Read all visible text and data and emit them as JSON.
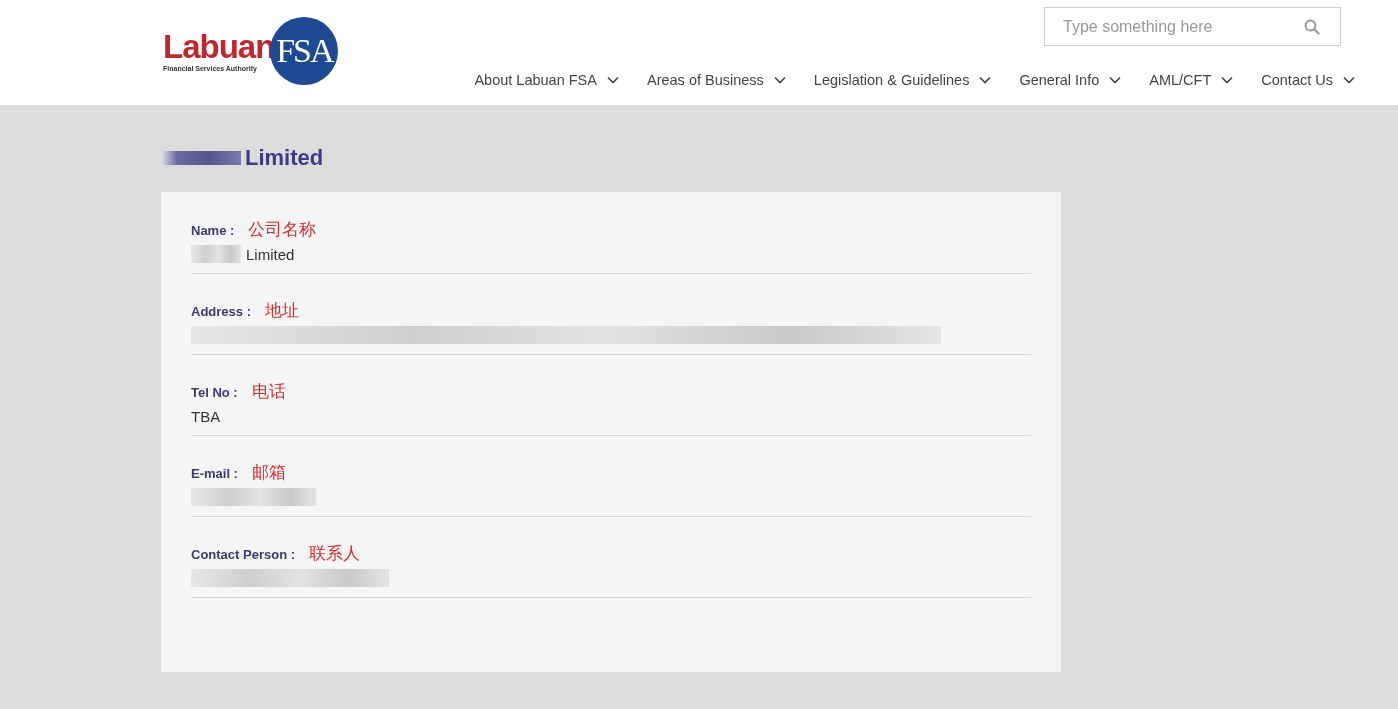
{
  "header": {
    "logo": {
      "word": "Labuan",
      "badge": "FSA",
      "tagline": "Financial Services Authority"
    },
    "search": {
      "placeholder": "Type something here"
    },
    "nav": [
      {
        "label": "About Labuan FSA"
      },
      {
        "label": "Areas of Business"
      },
      {
        "label": "Legislation & Guidelines"
      },
      {
        "label": "General Info"
      },
      {
        "label": "AML/CFT"
      },
      {
        "label": "Contact Us"
      }
    ]
  },
  "title": [
    {
      "kind": "redacted"
    },
    {
      "kind": "text",
      "text": "Limited"
    }
  ],
  "fields": [
    {
      "label": "Name :",
      "note": "公司名称",
      "value": [
        {
          "kind": "redacted"
        },
        {
          "kind": "text",
          "text": "Limited"
        }
      ]
    },
    {
      "label": "Address :",
      "note": "地址",
      "value": [
        {
          "kind": "redacted"
        }
      ]
    },
    {
      "label": "Tel No :",
      "note": "电话",
      "value": [
        {
          "kind": "text",
          "text": "TBA"
        }
      ]
    },
    {
      "label": "E-mail :",
      "note": "邮箱",
      "value": [
        {
          "kind": "redacted"
        }
      ]
    },
    {
      "label": "Contact Person :",
      "note": "联系人",
      "value": [
        {
          "kind": "redacted"
        }
      ]
    }
  ]
}
